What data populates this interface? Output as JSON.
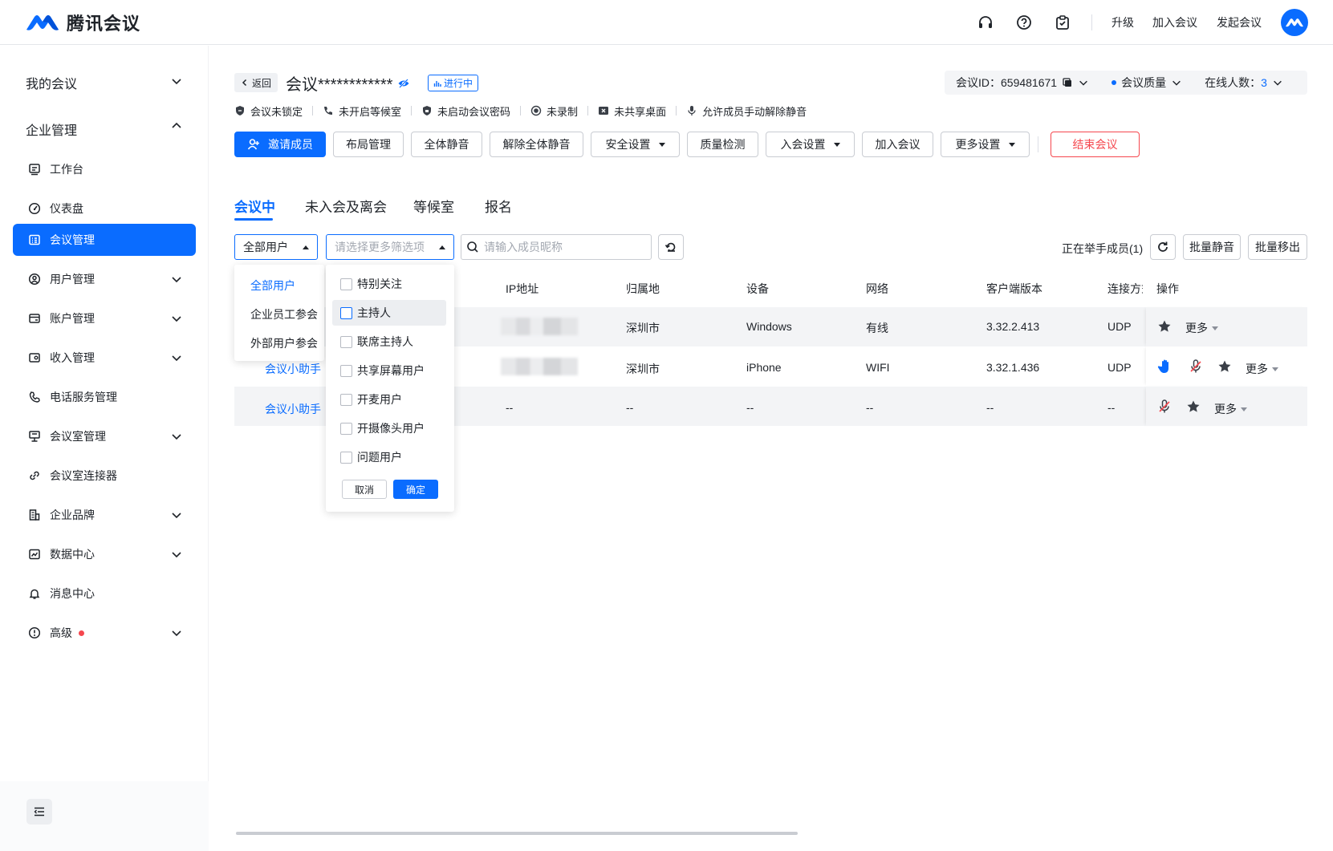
{
  "app": {
    "logo_text": "腾讯会议",
    "brand_color": "#0a6cff",
    "top_links": [
      "升级",
      "加入会议",
      "发起会议"
    ],
    "top_icons": [
      "headset-icon",
      "help-icon",
      "clipboard-check-icon"
    ]
  },
  "sidebar": {
    "groups": [
      {
        "label": "我的会议",
        "expanded": false
      },
      {
        "label": "企业管理",
        "expanded": true
      }
    ],
    "items": [
      {
        "label": "工作台",
        "icon": "monitor-icon",
        "expandable": false
      },
      {
        "label": "仪表盘",
        "icon": "gauge-icon",
        "expandable": false
      },
      {
        "label": "会议管理",
        "icon": "list-icon",
        "expandable": false,
        "active": true
      },
      {
        "label": "用户管理",
        "icon": "user-circle-icon",
        "expandable": true
      },
      {
        "label": "账户管理",
        "icon": "wallet-icon",
        "expandable": true
      },
      {
        "label": "收入管理",
        "icon": "income-icon",
        "expandable": true
      },
      {
        "label": "电话服务管理",
        "icon": "phone-icon",
        "expandable": false
      },
      {
        "label": "会议室管理",
        "icon": "room-icon",
        "expandable": true
      },
      {
        "label": "会议室连接器",
        "icon": "link-icon",
        "expandable": false
      },
      {
        "label": "企业品牌",
        "icon": "building-icon",
        "expandable": true
      },
      {
        "label": "数据中心",
        "icon": "chart-icon",
        "expandable": true
      },
      {
        "label": "消息中心",
        "icon": "bell-icon",
        "expandable": false
      },
      {
        "label": "高级",
        "icon": "advanced-icon",
        "expandable": true,
        "badge_dot": true
      }
    ]
  },
  "meeting": {
    "back_label": "返回",
    "title": "会议************",
    "status": "进行中",
    "id_label": "会议ID：",
    "id_value": "659481671",
    "quality_label": "会议质量",
    "online_label": "在线人数：",
    "online_count": "3",
    "stats": [
      "会议未锁定",
      "未开启等候室",
      "未启动会议密码",
      "未录制",
      "未共享桌面",
      "允许成员手动解除静音"
    ]
  },
  "actions": {
    "invite": "邀请成员",
    "layout": "布局管理",
    "mute_all": "全体静音",
    "unmute_all": "解除全体静音",
    "security": "安全设置",
    "quality_check": "质量检测",
    "join_settings": "入会设置",
    "join_meeting": "加入会议",
    "more_settings": "更多设置",
    "end_meeting": "结束会议"
  },
  "tabs": [
    "会议中",
    "未入会及离会",
    "等候室",
    "报名"
  ],
  "filters": {
    "user_type_value": "全部用户",
    "more_placeholder": "请选择更多筛选项",
    "search_placeholder": "请输入成员昵称",
    "raising_hand": "正在举手成员(1)",
    "batch_mute": "批量静音",
    "batch_remove": "批量移出"
  },
  "table": {
    "headers": [
      "IP地址",
      "归属地",
      "设备",
      "网络",
      "客户端版本",
      "连接方式",
      "操作"
    ],
    "rows": [
      {
        "name": "",
        "location": "深圳市",
        "device": "Windows",
        "network": "有线",
        "version": "3.32.2.413",
        "conn": "UDP",
        "more": "更多"
      },
      {
        "name": "会议小助手",
        "location": "深圳市",
        "device": "iPhone",
        "network": "WIFI",
        "version": "3.32.1.436",
        "conn": "UDP",
        "more": "更多"
      },
      {
        "name": "会议小助手",
        "ip": "--",
        "location": "--",
        "device": "--",
        "network": "--",
        "version": "--",
        "conn": "--",
        "more": "更多"
      }
    ]
  },
  "dropdown_user_type": {
    "options": [
      "全部用户",
      "企业员工参会",
      "外部用户参会"
    ],
    "selected": "全部用户"
  },
  "dropdown_more_filters": {
    "options": [
      "特别关注",
      "主持人",
      "联席主持人",
      "共享屏幕用户",
      "开麦用户",
      "开摄像头用户",
      "问题用户"
    ],
    "hovered": "主持人",
    "cancel": "取消",
    "confirm": "确定"
  }
}
